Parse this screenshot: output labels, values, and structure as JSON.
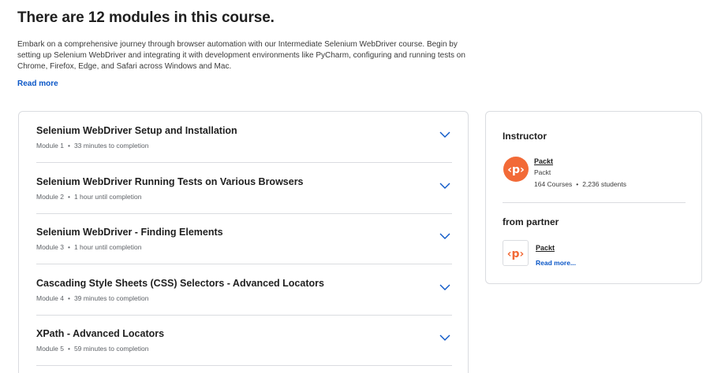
{
  "header": {
    "title": "There are 12 modules in this course.",
    "description": "Embark on a comprehensive journey through browser automation with our Intermediate Selenium WebDriver course. Begin by setting up Selenium WebDriver and integrating it with development environments like PyCharm, configuring and running tests on Chrome, Firefox, Edge, and Safari across Windows and Mac.",
    "read_more": "Read more"
  },
  "modules": [
    {
      "title": "Selenium WebDriver Setup and Installation",
      "module": "Module 1",
      "duration": "33 minutes to completion"
    },
    {
      "title": "Selenium WebDriver Running Tests on Various Browsers",
      "module": "Module 2",
      "duration": "1 hour until completion"
    },
    {
      "title": "Selenium WebDriver - Finding Elements",
      "module": "Module 3",
      "duration": "1 hour until completion"
    },
    {
      "title": "Cascading Style Sheets (CSS) Selectors - Advanced Locators",
      "module": "Module 4",
      "duration": "39 minutes to completion"
    },
    {
      "title": "XPath - Advanced Locators",
      "module": "Module 5",
      "duration": "59 minutes to completion"
    }
  ],
  "sidebar": {
    "instructor_heading": "Instructor",
    "instructor": {
      "name": "Packt",
      "org": "Packt",
      "courses": "164 Courses",
      "students": "2,236 students"
    },
    "partner_heading": "from partner",
    "partner": {
      "name": "Packt",
      "read_more": "Read more..."
    }
  },
  "colors": {
    "accent": "#0a56c7",
    "brand_orange": "#f26a37",
    "divider": "#dadce0"
  },
  "icons": {
    "module_toggle": "chevron-down-icon",
    "instructor_logo": "packt-logo",
    "partner_logo": "packt-logo"
  }
}
